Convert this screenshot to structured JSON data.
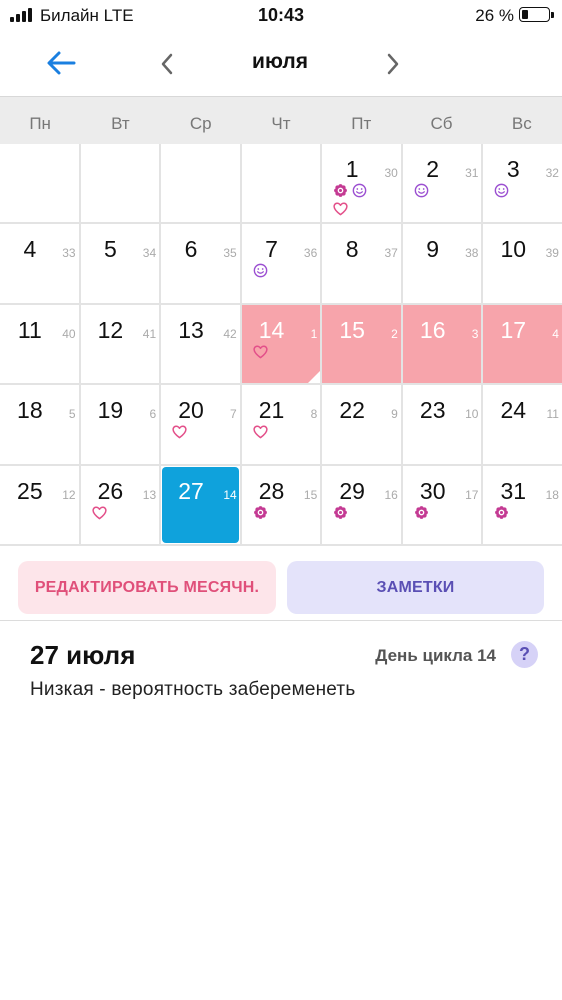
{
  "status_bar": {
    "carrier": "Билайн  LTE",
    "time": "10:43",
    "battery_percent": "26 %",
    "battery_level": 0.26,
    "signal_icon": "signal-bars-icon",
    "battery_icon": "battery-icon"
  },
  "header": {
    "title": "июля",
    "back_icon": "arrow-left-icon",
    "prev_icon": "chevron-left-icon",
    "next_icon": "chevron-right-icon"
  },
  "colors": {
    "accent_blue": "#1a7fe0",
    "period_pink": "#f7a4ab",
    "today_blue": "#0fa2dc",
    "heart_pink": "#e3508a",
    "smile_purple": "#9b4fd1",
    "ovulation_magenta": "#c43a93"
  },
  "weekdays": [
    "Пн",
    "Вт",
    "Ср",
    "Чт",
    "Пт",
    "Сб",
    "Вс"
  ],
  "calendar": {
    "weeks": [
      [
        {
          "day": "",
          "cycle": "",
          "marks": []
        },
        {
          "day": "",
          "cycle": "",
          "marks": []
        },
        {
          "day": "",
          "cycle": "",
          "marks": []
        },
        {
          "day": "",
          "cycle": "",
          "marks": []
        },
        {
          "day": "1",
          "cycle": "30",
          "marks": [
            "flower",
            "smile",
            "heart"
          ]
        },
        {
          "day": "2",
          "cycle": "31",
          "marks": [
            "smile"
          ]
        },
        {
          "day": "3",
          "cycle": "32",
          "marks": [
            "smile"
          ]
        }
      ],
      [
        {
          "day": "4",
          "cycle": "33",
          "marks": []
        },
        {
          "day": "5",
          "cycle": "34",
          "marks": []
        },
        {
          "day": "6",
          "cycle": "35",
          "marks": []
        },
        {
          "day": "7",
          "cycle": "36",
          "marks": [
            "smile"
          ]
        },
        {
          "day": "8",
          "cycle": "37",
          "marks": []
        },
        {
          "day": "9",
          "cycle": "38",
          "marks": []
        },
        {
          "day": "10",
          "cycle": "39",
          "marks": []
        }
      ],
      [
        {
          "day": "11",
          "cycle": "40",
          "marks": []
        },
        {
          "day": "12",
          "cycle": "41",
          "marks": []
        },
        {
          "day": "13",
          "cycle": "42",
          "marks": []
        },
        {
          "day": "14",
          "cycle": "1",
          "marks": [
            "heart"
          ],
          "state": "period-first"
        },
        {
          "day": "15",
          "cycle": "2",
          "marks": [],
          "state": "period"
        },
        {
          "day": "16",
          "cycle": "3",
          "marks": [],
          "state": "period"
        },
        {
          "day": "17",
          "cycle": "4",
          "marks": [],
          "state": "period"
        }
      ],
      [
        {
          "day": "18",
          "cycle": "5",
          "marks": []
        },
        {
          "day": "19",
          "cycle": "6",
          "marks": []
        },
        {
          "day": "20",
          "cycle": "7",
          "marks": [
            "heart"
          ]
        },
        {
          "day": "21",
          "cycle": "8",
          "marks": [
            "heart"
          ]
        },
        {
          "day": "22",
          "cycle": "9",
          "marks": []
        },
        {
          "day": "23",
          "cycle": "10",
          "marks": []
        },
        {
          "day": "24",
          "cycle": "11",
          "marks": []
        }
      ],
      [
        {
          "day": "25",
          "cycle": "12",
          "marks": []
        },
        {
          "day": "26",
          "cycle": "13",
          "marks": [
            "heart"
          ]
        },
        {
          "day": "27",
          "cycle": "14",
          "marks": [],
          "state": "today"
        },
        {
          "day": "28",
          "cycle": "15",
          "marks": [
            "flower"
          ]
        },
        {
          "day": "29",
          "cycle": "16",
          "marks": [
            "flower"
          ]
        },
        {
          "day": "30",
          "cycle": "17",
          "marks": [
            "flower"
          ]
        },
        {
          "day": "31",
          "cycle": "18",
          "marks": [
            "flower"
          ]
        }
      ]
    ]
  },
  "actions": {
    "edit_period": "РЕДАКТИРОВАТЬ МЕСЯЧН.",
    "notes": "ЗАМЕТКИ"
  },
  "details": {
    "selected_date": "27 июля",
    "cycle_day": "День цикла 14",
    "help_label": "?",
    "pregnancy_chance": "Низкая - вероятность забеременеть"
  }
}
